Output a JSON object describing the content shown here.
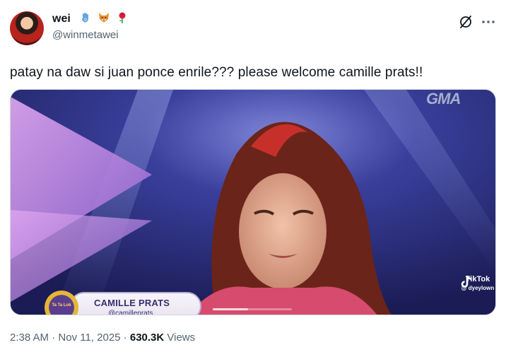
{
  "author": {
    "display_name": "wei",
    "handle": "@winmetawei",
    "name_emojis": [
      "hamsa-emoji",
      "fox-emoji",
      "rose-emoji"
    ]
  },
  "icons": {
    "grok": "grok-icon",
    "more": "more-options-icon"
  },
  "tweet": {
    "text": "patay na daw si juan ponce enrile??? please welcome camille prats!!"
  },
  "media": {
    "type": "video",
    "broadcaster_logo": "GMA",
    "lower_third_name": "CAMILLE PRATS",
    "lower_third_handle": "@camilleprats",
    "show_badge_text": "Ta Ta Lok",
    "watermark_app": "TikTok",
    "watermark_user": "@ dyeylown",
    "progress": 0.45
  },
  "meta": {
    "time": "2:38 AM",
    "separator": " · ",
    "date": "Nov 11, 2025",
    "views_count": "630.3K",
    "views_label": " Views"
  },
  "colors": {
    "text_primary": "#0f1419",
    "text_secondary": "#536471",
    "border": "#cfd9de"
  }
}
